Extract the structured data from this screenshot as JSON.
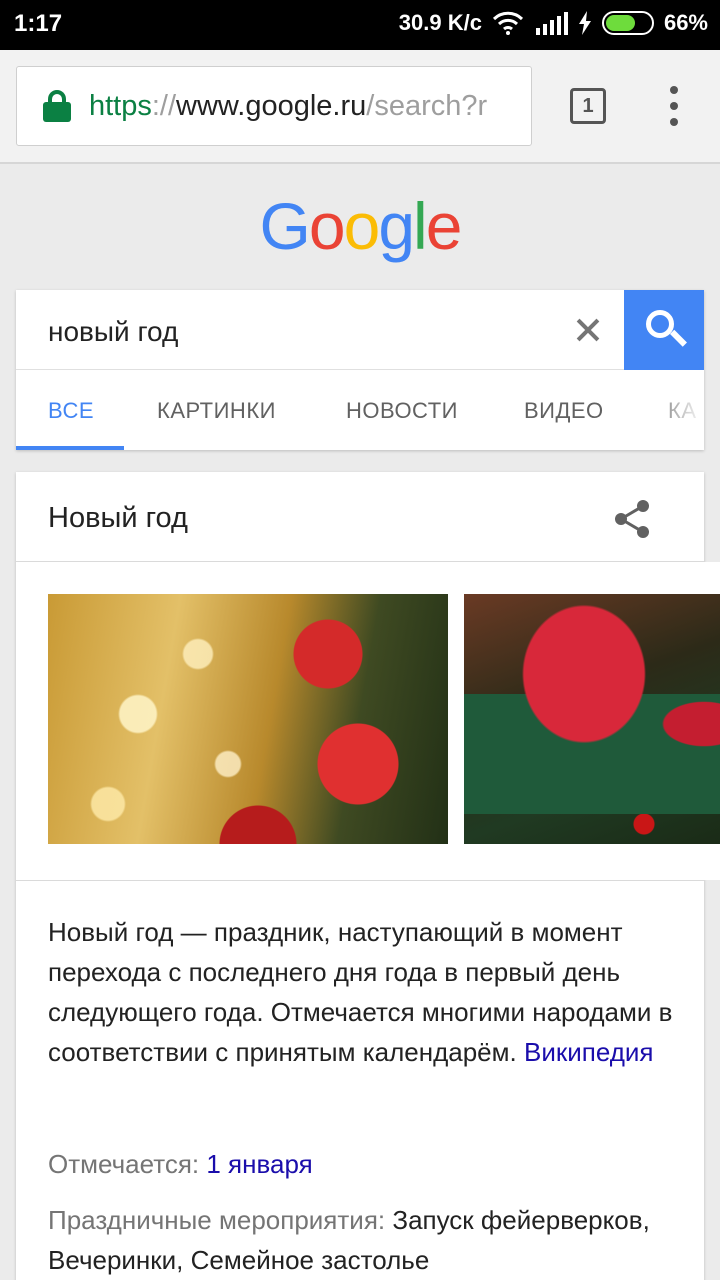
{
  "status_bar": {
    "time": "1:17",
    "network_speed": "30.9 K/c",
    "battery_percent": "66%",
    "battery_level": 0.66,
    "icons": [
      "wifi-icon",
      "signal-icon",
      "charging-icon",
      "battery-icon"
    ]
  },
  "browser": {
    "url_scheme": "https",
    "url_sep": "://",
    "url_host": "www.google.ru",
    "url_path": "/search?r",
    "tab_count": "1",
    "lock_color": "#0b8043"
  },
  "logo": {
    "letters": [
      "G",
      "o",
      "o",
      "g",
      "l",
      "e"
    ],
    "colors": [
      "#4285f4",
      "#ea4335",
      "#fbbc05",
      "#4285f4",
      "#34a853",
      "#ea4335"
    ]
  },
  "search": {
    "query": "новый год",
    "tabs": [
      "ВСЕ",
      "КАРТИНКИ",
      "НОВОСТИ",
      "ВИДЕО",
      "КА"
    ],
    "active_tab": "ВСЕ",
    "accent": "#4285f4"
  },
  "knowledge": {
    "title": "Новый год",
    "description": "Новый год — праздник, наступающий в момент перехода с последнего дня года в первый день следующего года. Отмечается многими народами в соответствии с принятым календарём.",
    "source_link": "Википедия",
    "facts": [
      {
        "label": "Отмечается:",
        "value": "1 января"
      },
      {
        "label": "Праздничные мероприятия:",
        "value": "Запуск фейерверков, Вечеринки, Семейное застолье"
      }
    ],
    "link_color": "#1a0dab"
  }
}
